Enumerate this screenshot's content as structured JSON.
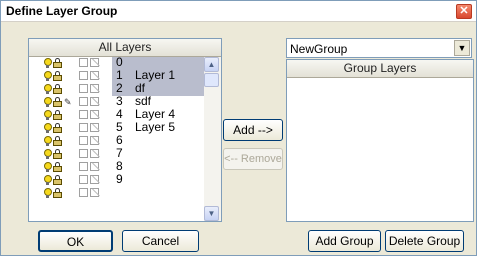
{
  "window": {
    "title": "Define Layer Group",
    "close_glyph": "✕"
  },
  "all_layers": {
    "header": "All Layers",
    "rows": [
      {
        "num": "0",
        "name": "",
        "selected": true,
        "pencil": false
      },
      {
        "num": "1",
        "name": "Layer 1",
        "selected": true,
        "pencil": false
      },
      {
        "num": "2",
        "name": "df",
        "selected": true,
        "pencil": false
      },
      {
        "num": "3",
        "name": "sdf",
        "selected": false,
        "pencil": true
      },
      {
        "num": "4",
        "name": "Layer 4",
        "selected": false,
        "pencil": false
      },
      {
        "num": "5",
        "name": "Layer 5",
        "selected": false,
        "pencil": false
      },
      {
        "num": "6",
        "name": "",
        "selected": false,
        "pencil": false
      },
      {
        "num": "7",
        "name": "",
        "selected": false,
        "pencil": false
      },
      {
        "num": "8",
        "name": "",
        "selected": false,
        "pencil": false
      },
      {
        "num": "9",
        "name": "",
        "selected": false,
        "pencil": false
      },
      {
        "num": "",
        "name": "",
        "selected": false,
        "pencil": false
      }
    ]
  },
  "group": {
    "selected_group": "NewGroup",
    "header": "Group Layers"
  },
  "buttons": {
    "add": "Add -->",
    "remove": "<-- Remove",
    "ok": "OK",
    "cancel": "Cancel",
    "add_group": "Add Group",
    "delete_group": "Delete Group"
  },
  "icons": {
    "visibility": "lightbulb-icon",
    "lock": "padlock-icon",
    "edit": "pencil-icon",
    "scroll_up": "▲",
    "scroll_down": "▼",
    "combo_arrow": "▼"
  }
}
